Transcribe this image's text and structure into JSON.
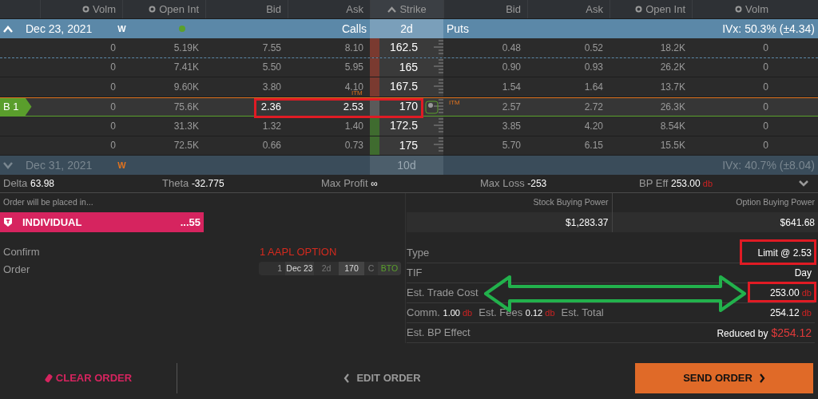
{
  "columns": [
    {
      "label": "Volm",
      "kind": "dot"
    },
    {
      "label": "Open Int",
      "kind": "dot"
    },
    {
      "label": "Bid",
      "kind": "plain"
    },
    {
      "label": "Ask",
      "kind": "plain"
    },
    {
      "label": "Strike",
      "kind": "caret"
    },
    {
      "label": "Bid",
      "kind": "plain"
    },
    {
      "label": "Ask",
      "kind": "plain"
    },
    {
      "label": "Open Int",
      "kind": "dot"
    },
    {
      "label": "Volm",
      "kind": "dot"
    }
  ],
  "expirations": [
    {
      "date": "Dec 23, 2021",
      "flag": "W",
      "expanded": true,
      "color": "#5aa02c",
      "calls_label": "Calls",
      "days": "2d",
      "puts_label": "Puts",
      "ivx": "IVx: 50.3% (±4.34)",
      "itm_marks": [
        "ITM",
        "ITM"
      ],
      "rows": [
        {
          "call_volm": "0",
          "call_oi": "5.19K",
          "call_bid": "7.55",
          "call_ask": "8.10",
          "strike": "162.5",
          "put_bid": "0.48",
          "put_ask": "0.52",
          "put_oi": "18.2K",
          "put_volm": "0",
          "itm": true,
          "selected": false
        },
        {
          "call_volm": "0",
          "call_oi": "7.41K",
          "call_bid": "5.50",
          "call_ask": "5.95",
          "strike": "165",
          "put_bid": "0.90",
          "put_ask": "0.93",
          "put_oi": "26.2K",
          "put_volm": "0",
          "itm": true,
          "selected": false
        },
        {
          "call_volm": "0",
          "call_oi": "9.60K",
          "call_bid": "3.80",
          "call_ask": "4.10",
          "strike": "167.5",
          "put_bid": "1.54",
          "put_ask": "1.64",
          "put_oi": "13.7K",
          "put_volm": "0",
          "itm": true,
          "selected": false
        },
        {
          "position": "B 1",
          "call_volm": "0",
          "call_oi": "75.6K",
          "call_bid": "2.36",
          "call_ask": "2.53",
          "strike": "170",
          "put_bid": "2.57",
          "put_ask": "2.72",
          "put_oi": "26.3K",
          "put_volm": "0",
          "itm": false,
          "selected": true
        },
        {
          "call_volm": "0",
          "call_oi": "31.3K",
          "call_bid": "1.32",
          "call_ask": "1.40",
          "strike": "172.5",
          "put_bid": "3.85",
          "put_ask": "4.20",
          "put_oi": "8.54K",
          "put_volm": "0",
          "itm": false,
          "selected": false
        },
        {
          "call_volm": "0",
          "call_oi": "72.5K",
          "call_bid": "0.66",
          "call_ask": "0.73",
          "strike": "175",
          "put_bid": "5.70",
          "put_ask": "6.15",
          "put_oi": "15.5K",
          "put_volm": "0",
          "itm": false,
          "selected": false
        }
      ]
    },
    {
      "date": "Dec 31, 2021",
      "flag": "W",
      "expanded": false,
      "days": "10d",
      "ivx": "IVx: 40.7% (±8.04)"
    }
  ],
  "greeks": [
    {
      "label": "Delta",
      "value": "63.98"
    },
    {
      "label": "Theta",
      "value": "-32.775"
    },
    {
      "label": "Max Profit",
      "value": "∞"
    },
    {
      "label": "Max Loss",
      "value": "-253"
    },
    {
      "label": "BP Eff",
      "value": "253.00",
      "unit": "db"
    }
  ],
  "account": {
    "caption": "Order will be placed in...",
    "name": "INDIVIDUAL",
    "number": "...55"
  },
  "buying_power": [
    {
      "label": "Stock Buying Power",
      "value": "$1,283.37"
    },
    {
      "label": "Option Buying Power",
      "value": "$641.68"
    }
  ],
  "confirm": {
    "label": "Confirm",
    "title": "1 AAPL OPTION"
  },
  "order": {
    "label": "Order",
    "legs": [
      {
        "qty": "1",
        "date": "Dec 23",
        "days": "2d",
        "strike": "170",
        "type": "C",
        "action": "BTO"
      }
    ]
  },
  "details": [
    {
      "kind": "plain",
      "label": "Type",
      "value": "Limit @ 2.53"
    },
    {
      "kind": "plain",
      "label": "TIF",
      "value": "Day"
    },
    {
      "kind": "plain",
      "label": "Est. Trade Cost",
      "value": "253.00",
      "unit": "db"
    },
    {
      "kind": "costs",
      "parts": [
        {
          "label": "Comm.",
          "value": "1.00",
          "unit": "db"
        },
        {
          "label": "Est. Fees",
          "value": "0.12",
          "unit": "db"
        },
        {
          "label": "Est. Total"
        }
      ],
      "value": "254.12",
      "unit": "db"
    },
    {
      "kind": "effect",
      "label": "Est. BP Effect",
      "value": "Reduced by",
      "amount": "$254.12"
    }
  ],
  "buttons": [
    {
      "label": "CLEAR ORDER",
      "kind": "clear"
    },
    {
      "label": "EDIT ORDER",
      "kind": "edit"
    },
    {
      "label": "SEND ORDER",
      "kind": "send"
    }
  ]
}
